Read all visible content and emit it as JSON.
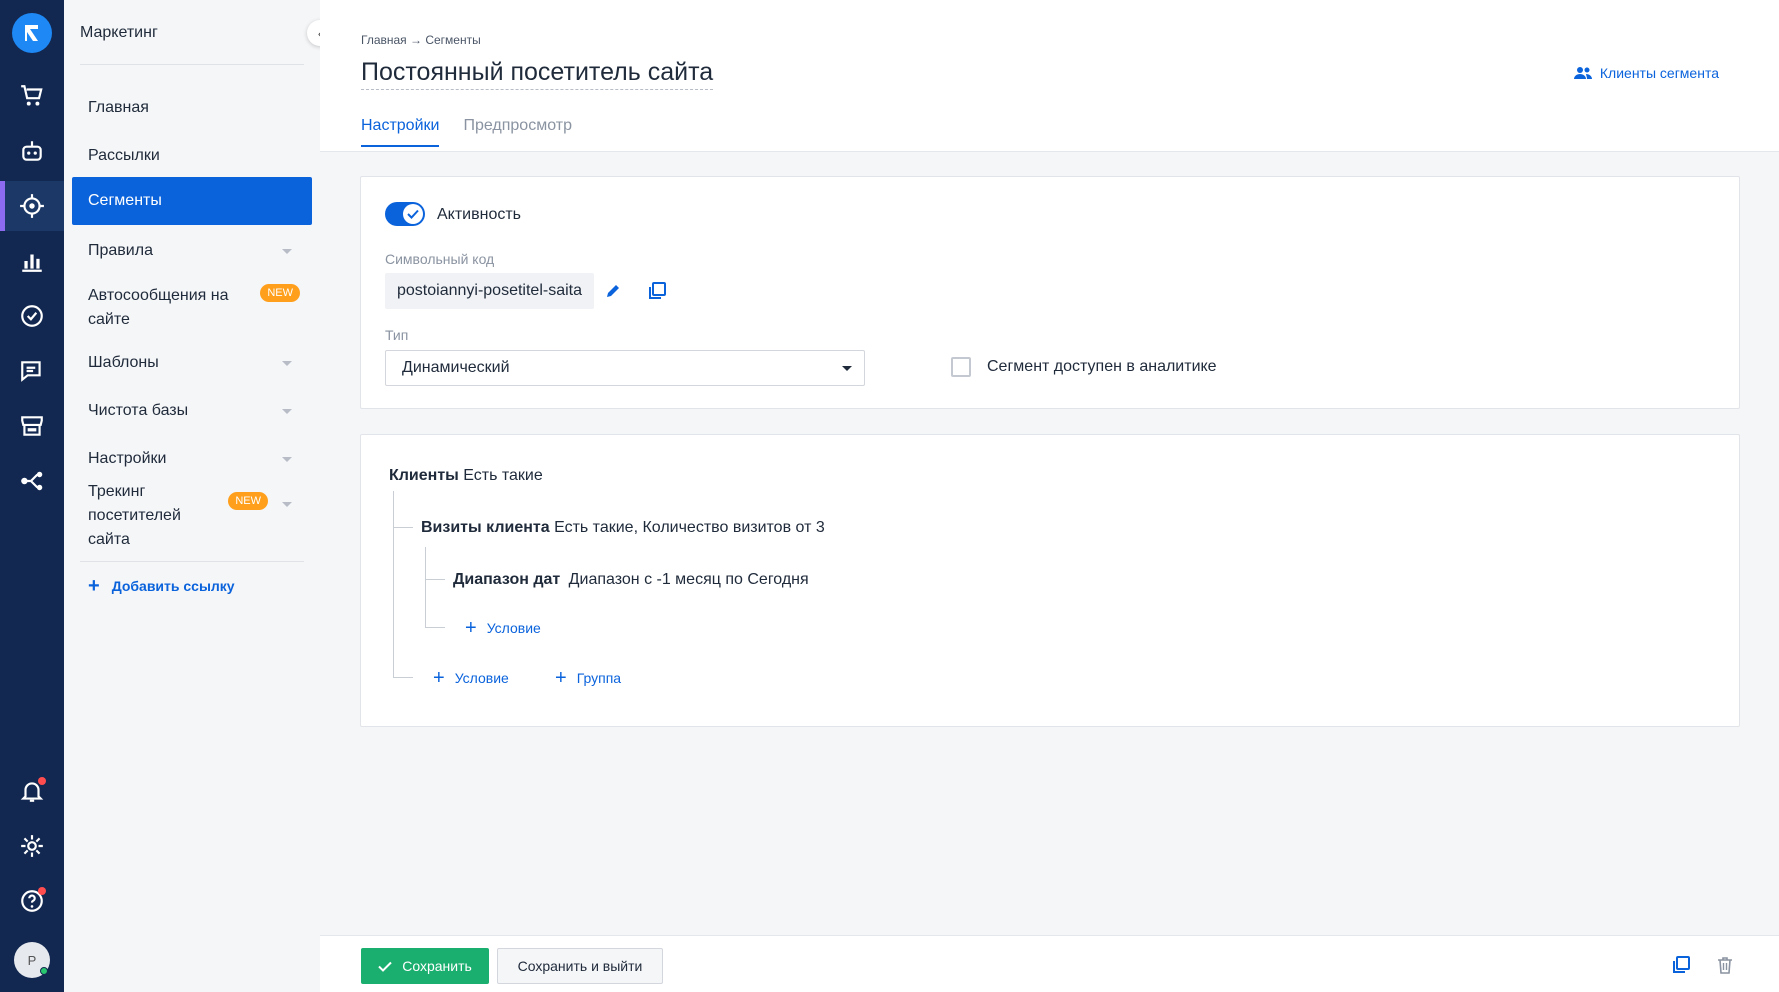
{
  "rail": {
    "items": [
      {
        "icon": "cart-icon"
      },
      {
        "icon": "robot-icon"
      },
      {
        "icon": "target-icon"
      },
      {
        "icon": "analytics-icon"
      },
      {
        "icon": "check-circle-icon"
      },
      {
        "icon": "chat-icon"
      },
      {
        "icon": "store-icon"
      },
      {
        "icon": "share-icon"
      }
    ],
    "bottom": [
      {
        "icon": "bell-icon"
      },
      {
        "icon": "gear-icon"
      },
      {
        "icon": "help-icon"
      }
    ],
    "avatar_letter": "P",
    "colors": {
      "bg": "#122850",
      "accent": "#8d6bf0",
      "logo": "#1e88f5"
    }
  },
  "sidebar": {
    "title": "Маркетинг",
    "items": [
      {
        "label": "Главная"
      },
      {
        "label": "Рассылки"
      },
      {
        "label": "Сегменты",
        "active": true
      },
      {
        "label": "Правила"
      },
      {
        "label": "Автосообщения на сайте",
        "badge": "NEW"
      },
      {
        "label": "Шаблоны"
      },
      {
        "label": "Чистота базы"
      },
      {
        "label": "Настройки"
      },
      {
        "label": "Трекинг посетителей сайта",
        "badge": "NEW"
      }
    ],
    "add_link": "Добавить ссылку"
  },
  "header": {
    "breadcrumb": "Главная → Сегменты",
    "title": "Постоянный посетитель сайта",
    "segment_clients": "Клиенты сегмента"
  },
  "tabs": [
    {
      "label": "Настройки",
      "active": true
    },
    {
      "label": "Предпросмотр"
    }
  ],
  "settings": {
    "activity_label": "Активность",
    "activity_on": true,
    "code_label": "Символьный код",
    "code_value": "postoiannyi-posetitel-saita",
    "type_label": "Тип",
    "type_value": "Динамический",
    "analytics_label": "Сегмент доступен в аналитике",
    "analytics_checked": false
  },
  "filter": {
    "root": {
      "name": "Клиенты",
      "desc": "Есть такие"
    },
    "child": {
      "name": "Визиты клиента",
      "desc": "Есть такие, Количество визитов от 3"
    },
    "grandchild": {
      "name": "Диапазон дат",
      "desc": "Диапазон с -1 месяц по Сегодня"
    },
    "inner_add_condition": "Условие",
    "add_condition": "Условие",
    "add_group": "Группа"
  },
  "footer": {
    "save": "Сохранить",
    "save_exit": "Сохранить и выйти"
  },
  "colors": {
    "primary": "#0b63dc",
    "save": "#1aae6f",
    "badge": "#ff9f1c"
  }
}
